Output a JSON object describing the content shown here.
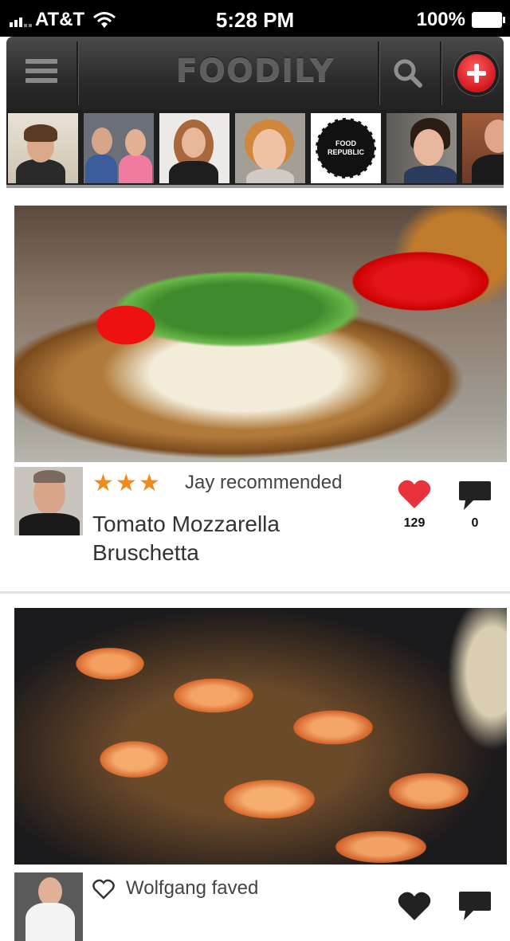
{
  "status_bar": {
    "carrier": "AT&T",
    "time": "5:28 PM",
    "battery": "100%"
  },
  "nav": {
    "logo": "FOODILY",
    "icons": [
      "menu-icon",
      "search-icon",
      "plus-icon"
    ]
  },
  "avatar_strip": {
    "badge_text": "FOOD REPUBLIC"
  },
  "feed": [
    {
      "rating_stars": 3,
      "activity": "Jay recommended",
      "title": "Tomato Mozzarella Bruschetta",
      "likes": "129",
      "comments": "0",
      "like_color": "#e8323c"
    },
    {
      "activity": "Wolfgang faved",
      "like_color": "#222222"
    }
  ],
  "colors": {
    "accent": "#f08a1c",
    "brand_red": "#d11820"
  }
}
